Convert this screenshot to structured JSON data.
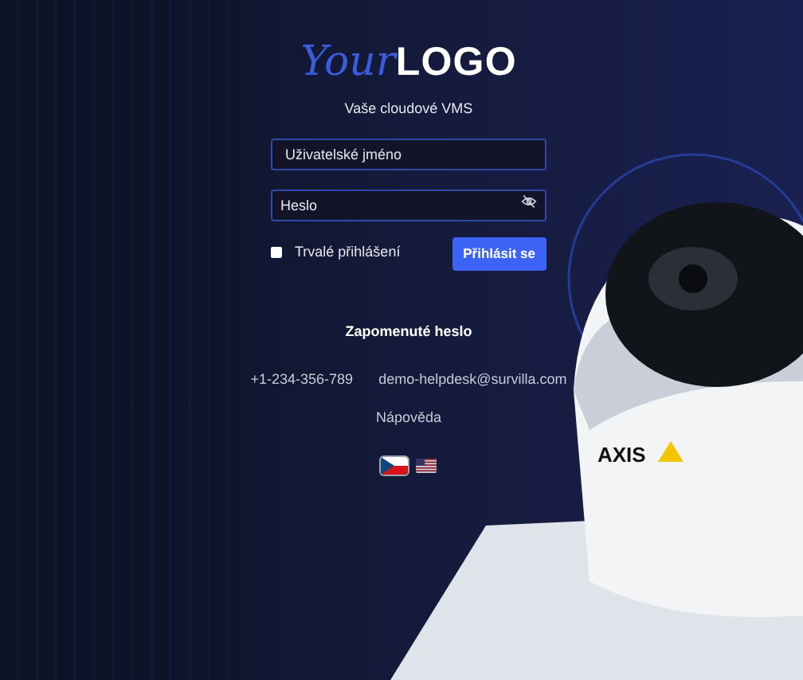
{
  "logo": {
    "script": "Your",
    "bold": "LOGO"
  },
  "subtitle": "Vaše cloudové VMS",
  "username": {
    "placeholder": "Uživatelské jméno"
  },
  "password": {
    "placeholder": "Heslo"
  },
  "remember": {
    "label": "Trvalé přihlášení",
    "checked": false
  },
  "login_button": "Přihlásit se",
  "forgot_password": "Zapomenuté heslo",
  "phone": "+1-234-356-789",
  "email": "demo-helpdesk@survilla.com",
  "help": "Nápověda",
  "languages": [
    {
      "kind": "cz",
      "selected": true
    },
    {
      "kind": "us",
      "selected": false
    }
  ],
  "camera_brand": "AXIS"
}
